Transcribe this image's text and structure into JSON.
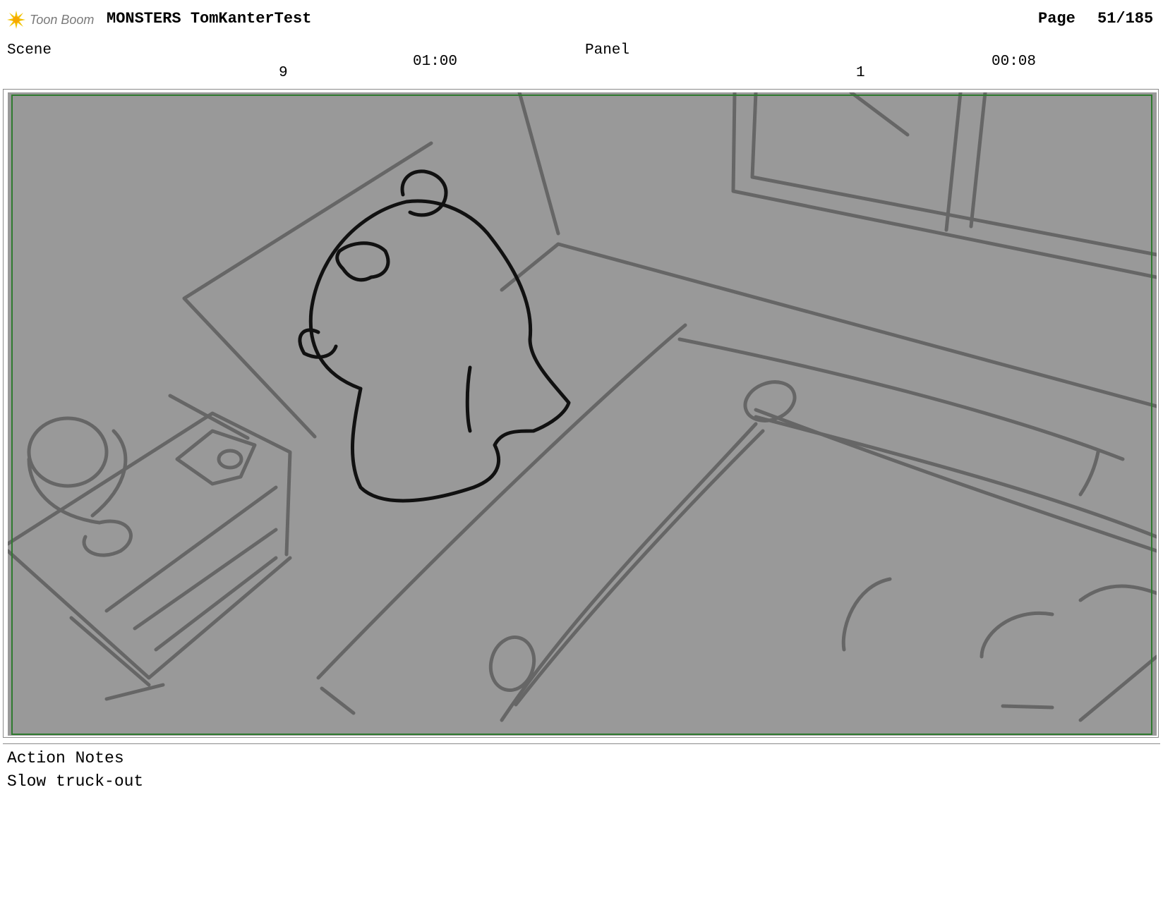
{
  "header": {
    "logo_text": "Toon Boom",
    "title": "MONSTERS TomKanterTest",
    "page_label": "Page",
    "page_value": "51/185"
  },
  "scene": {
    "label": "Scene",
    "number": "9",
    "duration": "01:00"
  },
  "panel": {
    "label": "Panel",
    "number": "1",
    "duration": "00:08"
  },
  "notes": {
    "label": "Action Notes",
    "text": "Slow truck-out"
  },
  "colors": {
    "frame_fill": "#999999",
    "sketch_gray": "#666666",
    "character_ink": "#111111",
    "safe_area_border": "#2f7a2f",
    "logo_accent": "#f2c200"
  }
}
